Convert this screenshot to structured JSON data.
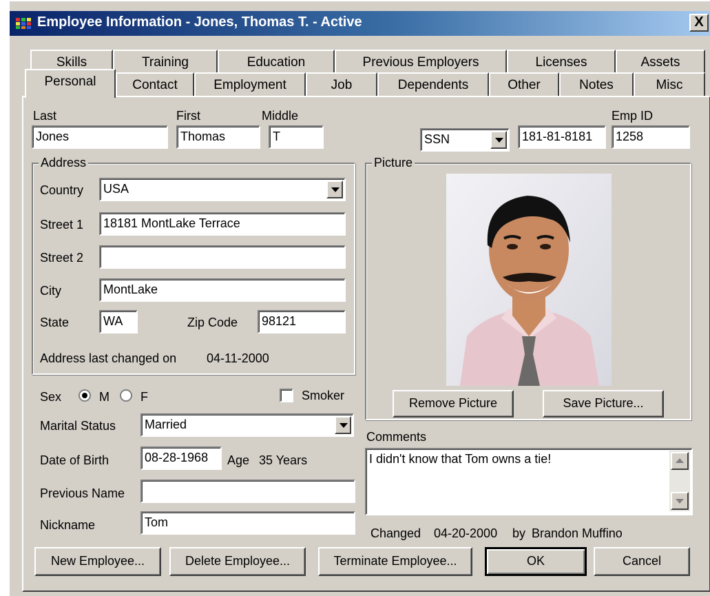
{
  "window": {
    "title": "Employee Information - Jones, Thomas T. - Active",
    "close_label": "X"
  },
  "tabs": {
    "row1": [
      "Skills",
      "Training",
      "Education",
      "Previous Employers",
      "Licenses",
      "Assets"
    ],
    "row2": [
      "Personal",
      "Contact",
      "Employment",
      "Job",
      "Dependents",
      "Other",
      "Notes",
      "Misc"
    ],
    "active": "Personal"
  },
  "name": {
    "last_label": "Last",
    "last_value": "Jones",
    "first_label": "First",
    "first_value": "Thomas",
    "middle_label": "Middle",
    "middle_value": "T"
  },
  "id": {
    "id_type": "SSN",
    "ssn_value": "181-81-8181",
    "emp_id_label": "Emp ID",
    "emp_id_value": "1258"
  },
  "address": {
    "group_label": "Address",
    "country_label": "Country",
    "country_value": "USA",
    "street1_label": "Street 1",
    "street1_value": "18181 MontLake Terrace",
    "street2_label": "Street 2",
    "street2_value": "",
    "city_label": "City",
    "city_value": "MontLake",
    "state_label": "State",
    "state_value": "WA",
    "zip_label": "Zip Code",
    "zip_value": "98121",
    "last_changed_label": "Address last changed on",
    "last_changed_value": "04-11-2000"
  },
  "personal": {
    "sex_label": "Sex",
    "sex_m": "M",
    "sex_f": "F",
    "sex_selected": "M",
    "smoker_label": "Smoker",
    "smoker_checked": false,
    "marital_label": "Marital Status",
    "marital_value": "Married",
    "dob_label": "Date of Birth",
    "dob_value": "08-28-1968",
    "age_label": "Age",
    "age_value": "35 Years",
    "prev_name_label": "Previous Name",
    "prev_name_value": "",
    "nickname_label": "Nickname",
    "nickname_value": "Tom"
  },
  "picture": {
    "group_label": "Picture",
    "remove_label": "Remove Picture",
    "save_label": "Save Picture..."
  },
  "comments": {
    "label": "Comments",
    "value": "I didn't know that Tom owns a tie!",
    "changed_label": "Changed",
    "changed_date": "04-20-2000",
    "changed_by_label": "by",
    "changed_by": "Brandon Muffino"
  },
  "buttons": {
    "new": "New Employee...",
    "delete": "Delete Employee...",
    "terminate": "Terminate Employee...",
    "ok": "OK",
    "cancel": "Cancel"
  }
}
